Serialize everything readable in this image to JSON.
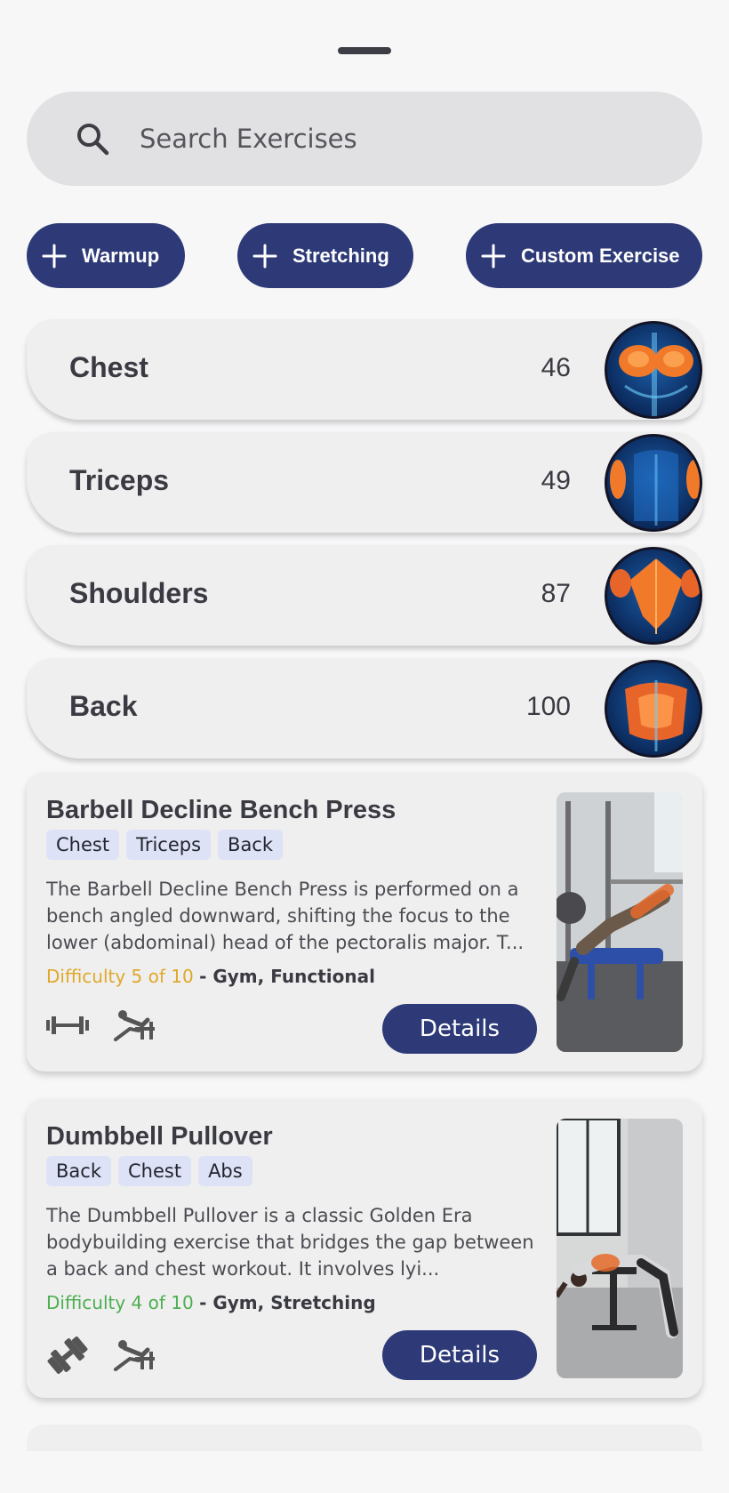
{
  "search": {
    "placeholder": "Search Exercises",
    "icon": "search-icon"
  },
  "quick_add": [
    {
      "label": "Warmup",
      "icon": "plus-icon"
    },
    {
      "label": "Stretching",
      "icon": "plus-icon"
    },
    {
      "label": "Custom Exercise",
      "icon": "plus-icon"
    }
  ],
  "categories": [
    {
      "name": "Chest",
      "count": "46"
    },
    {
      "name": "Triceps",
      "count": "49"
    },
    {
      "name": "Shoulders",
      "count": "87"
    },
    {
      "name": "Back",
      "count": "100"
    }
  ],
  "exercises": [
    {
      "title": "Barbell Decline Bench Press",
      "tags": [
        "Chest",
        "Triceps",
        "Back"
      ],
      "description": "The Barbell Decline Bench Press is performed on a bench angled downward, shifting the focus to the lower (abdominal) head of the pectoralis major. T...",
      "difficulty_text": "Difficulty 5 of 10",
      "difficulty_color": "#e0a82a",
      "types": "- Gym, Functional",
      "equipment_icons": [
        "barbell-icon",
        "bench-press-icon"
      ],
      "details_label": "Details"
    },
    {
      "title": "Dumbbell Pullover",
      "tags": [
        "Back",
        "Chest",
        "Abs"
      ],
      "description": "The Dumbbell Pullover is a classic Golden Era bodybuilding exercise that bridges the gap between a back and chest workout. It involves lyi...",
      "difficulty_text": "Difficulty 4 of 10",
      "difficulty_color": "#4caf50",
      "types": "- Gym, Stretching",
      "equipment_icons": [
        "dumbbell-icon",
        "bench-press-icon"
      ],
      "details_label": "Details"
    }
  ],
  "colors": {
    "accent": "#2d3a77",
    "tag_bg": "#dde2f6",
    "card_bg": "#efefef",
    "background": "#f7f7f8"
  }
}
